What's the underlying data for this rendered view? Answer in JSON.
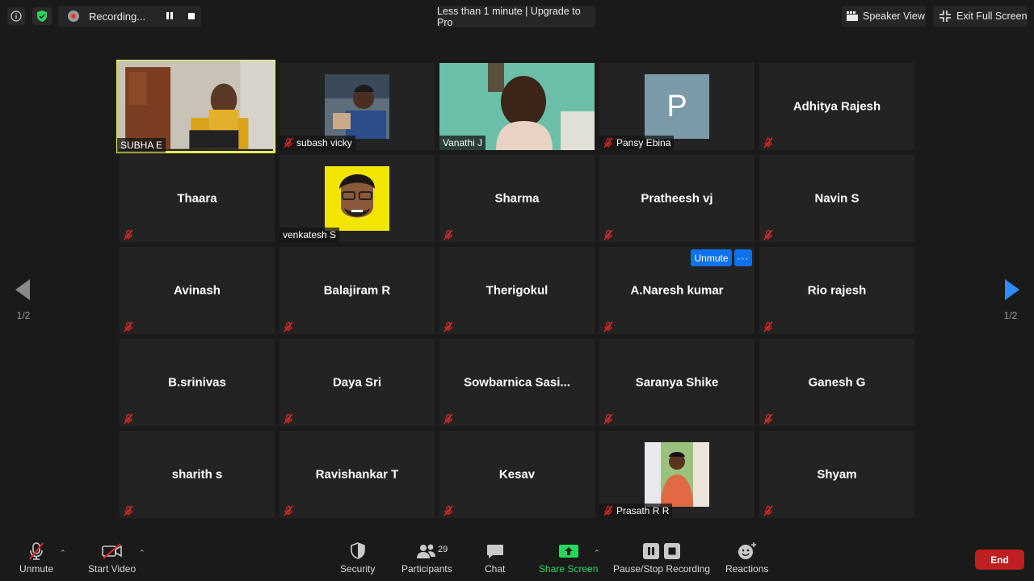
{
  "topbar": {
    "recording_label": "Recording...",
    "timer_text": "Less than 1 minute | Upgrade to Pro",
    "speaker_view_label": "Speaker View",
    "exit_fullscreen_label": "Exit Full Screen"
  },
  "nav": {
    "left_page": "1/2",
    "right_page": "1/2"
  },
  "participants": [
    {
      "name": "SUBHA E",
      "video": true
    },
    {
      "name": "subash vicky",
      "video": true
    },
    {
      "name": "Vanathi J",
      "video": true
    },
    {
      "name": "Pansy Ebina",
      "avatar_letter": "P"
    },
    {
      "name": "Adhitya Rajesh"
    },
    {
      "name": "Thaara"
    },
    {
      "name": "venkatesh S",
      "video": true
    },
    {
      "name": "Sharma"
    },
    {
      "name": "Pratheesh vj"
    },
    {
      "name": "Navin S"
    },
    {
      "name": "Avinash"
    },
    {
      "name": "Balajiram R"
    },
    {
      "name": "Therigokul"
    },
    {
      "name": "A.Naresh kumar"
    },
    {
      "name": "Rio rajesh"
    },
    {
      "name": "B.srinivas"
    },
    {
      "name": "Daya Sri"
    },
    {
      "name": "Sowbarnica  Sasi..."
    },
    {
      "name": "Saranya Shike"
    },
    {
      "name": "Ganesh G"
    },
    {
      "name": "sharith s"
    },
    {
      "name": "Ravishankar T"
    },
    {
      "name": "Kesav"
    },
    {
      "name": "Prasath R R",
      "video": true
    },
    {
      "name": "Shyam"
    }
  ],
  "hover_popup": {
    "unmute_label": "Unmute",
    "more_label": "···"
  },
  "toolbar": {
    "unmute_label": "Unmute",
    "start_video_label": "Start Video",
    "security_label": "Security",
    "participants_label": "Participants",
    "participants_count": "29",
    "chat_label": "Chat",
    "share_screen_label": "Share Screen",
    "pause_stop_label": "Pause/Stop Recording",
    "reactions_label": "Reactions",
    "end_label": "End"
  },
  "colors": {
    "background": "#1a1a1a",
    "tile": "#232323",
    "active_speaker": "#e6f25a",
    "accent_blue": "#0e72ed",
    "share_green": "#23d959",
    "mute_red": "#e02828",
    "end_red": "#c01f1f"
  }
}
